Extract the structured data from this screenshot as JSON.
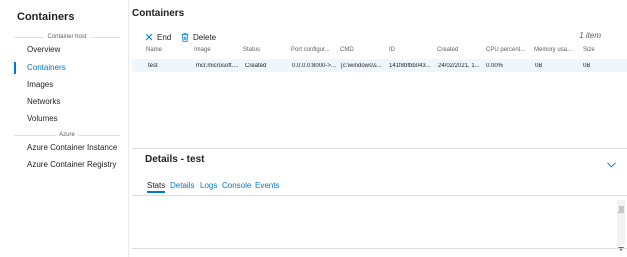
{
  "sidebar": {
    "title": "Containers",
    "section_container_host": "Container host",
    "items_host": [
      {
        "label": "Overview"
      },
      {
        "label": "Containers"
      },
      {
        "label": "Images"
      },
      {
        "label": "Networks"
      },
      {
        "label": "Volumes"
      }
    ],
    "section_azure": "Azure",
    "items_azure": [
      {
        "label": "Azure Container Instance"
      },
      {
        "label": "Azure Container Registry"
      }
    ],
    "active_item": "Containers"
  },
  "main": {
    "title": "Containers",
    "toolbar": {
      "end_label": "End",
      "delete_label": "Delete"
    },
    "count_label": "1 item",
    "columns": [
      "Name",
      "Image",
      "Status",
      "Port configur...",
      "CMD",
      "ID",
      "Created",
      "CPU percent...",
      "Memory usa...",
      "Size"
    ],
    "rows": [
      [
        "test",
        "mcr.microsoft....",
        "Created",
        "0.0.0.0:8000->...",
        "[c:\\windows\\s...",
        "141f8bfbb043...",
        "24/02/2021, 1...",
        "0.00%",
        "0B",
        "0B"
      ]
    ]
  },
  "details": {
    "title": "Details - test",
    "tabs": [
      {
        "label": "Stats"
      },
      {
        "label": "Details"
      },
      {
        "label": "Logs"
      },
      {
        "label": "Console"
      },
      {
        "label": "Events"
      }
    ],
    "active_tab": "Stats"
  },
  "colors": {
    "accent": "#0078d4",
    "selected_row": "#eff6fc"
  }
}
